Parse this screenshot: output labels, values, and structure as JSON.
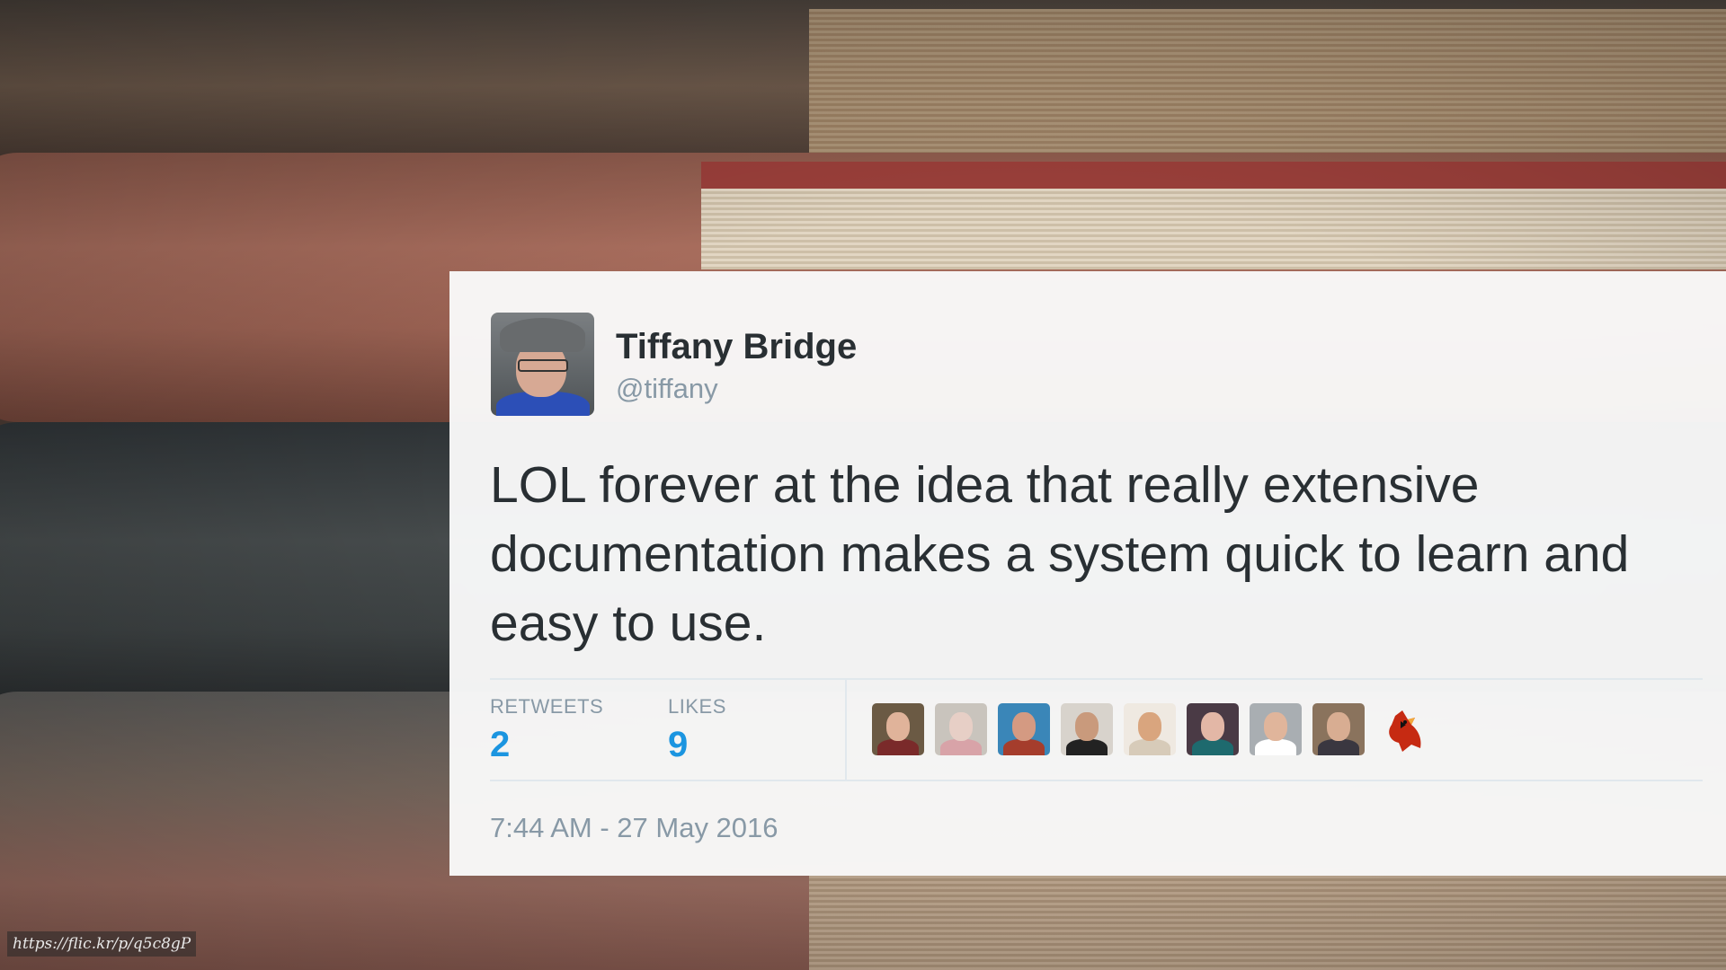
{
  "tweet": {
    "author_name": "Tiffany Bridge",
    "author_handle": "@tiffany",
    "text": "LOL forever at the idea that really extensive documentation makes a system quick to learn and easy to use.",
    "stats": {
      "retweets_label": "RETWEETS",
      "retweets_value": "2",
      "likes_label": "LIKES",
      "likes_value": "9"
    },
    "timestamp": "7:44 AM - 27 May 2016",
    "likers": [
      {
        "bg": "#6b5a44",
        "face": "#e0b39a",
        "shirt": "#7a2a2a"
      },
      {
        "bg": "#c9c4bd",
        "face": "#e7cfc6",
        "shirt": "#d8a3a8"
      },
      {
        "bg": "#3a86b8",
        "face": "#d49a82",
        "shirt": "#a53d2c"
      },
      {
        "bg": "#d8d3cc",
        "face": "#c99a7c",
        "shirt": "#222222"
      },
      {
        "bg": "#efe9e1",
        "face": "#d9a57e",
        "shirt": "#d7cbb9"
      },
      {
        "bg": "#4a3a45",
        "face": "#e3b7a6",
        "shirt": "#1e6a6e"
      },
      {
        "bg": "#a9aeb2",
        "face": "#e0b59b",
        "shirt": "#ffffff"
      },
      {
        "bg": "#8a735d",
        "face": "#d8ad92",
        "shirt": "#3a3740"
      }
    ],
    "bird_icon": "cardinal-icon"
  },
  "photo_credit": "https://flic.kr/p/q5c8gP",
  "colors": {
    "link_blue": "#1b95e0",
    "text_dark": "#292f33",
    "text_muted": "#8899a6"
  }
}
